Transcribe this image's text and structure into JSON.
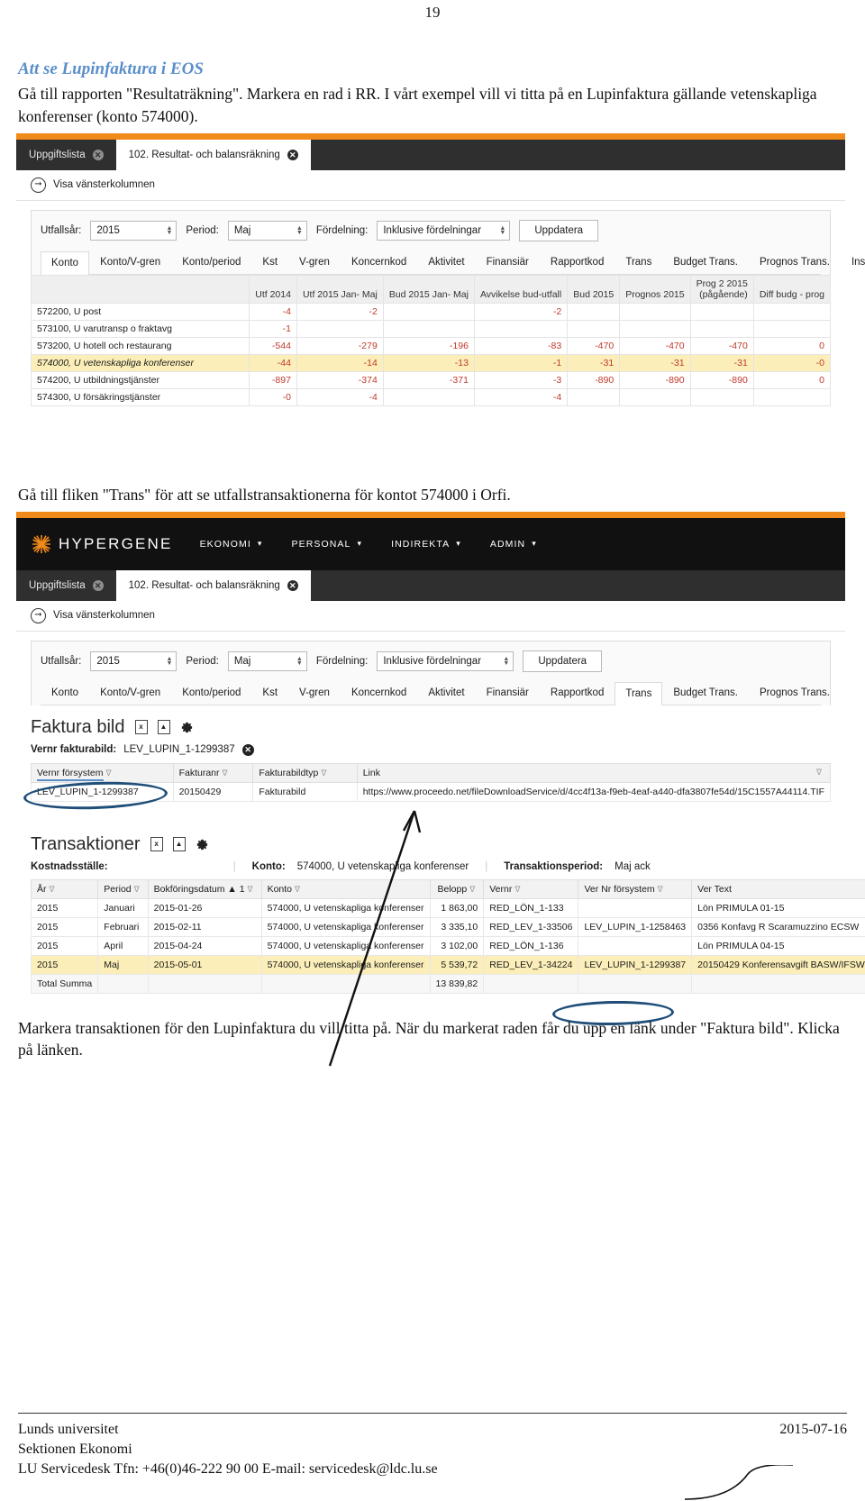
{
  "document": {
    "page_number": "19",
    "heading": "Att se Lupinfaktura i EOS",
    "intro_paragraph": "Gå till rapporten \"Resultaträkning\". Markera en rad i RR. I vårt exempel vill vi titta på en Lupinfaktura gällande vetenskapliga konferenser (konto 574000).",
    "middle_paragraph": "Gå till fliken \"Trans\" för att se utfallstransaktionerna för kontot 574000 i Orfi.",
    "closing_paragraph": "Markera transaktionen för den Lupinfaktura du vill titta på. När du markerat raden får du upp en länk under \"Faktura bild\". Klicka på länken.",
    "heading_color": "#5b8fc9"
  },
  "footer": {
    "org": "Lunds universitet",
    "date": "2015-07-16",
    "department": "Sektionen Ekonomi",
    "contact": "LU Servicedesk Tfn: +46(0)46-222 90 00 E-mail: servicedesk@ldc.lu.se"
  },
  "screenshot1": {
    "accent_color": "#f08a1a",
    "tabs": [
      {
        "label": "Uppgiftslista",
        "active": false,
        "close": "✕"
      },
      {
        "label": "102. Resultat- och balansräkning",
        "active": true,
        "close": "✕"
      }
    ],
    "left_column_toggle": "Visa vänsterkolumnen",
    "filters": [
      {
        "label": "Utfallsår:",
        "value": "2015"
      },
      {
        "label": "Period:",
        "value": "Maj"
      },
      {
        "label": "Fördelning:",
        "value": "Inklusive fördelningar"
      }
    ],
    "update_button": "Uppdatera",
    "subtabs": [
      {
        "label": "Konto",
        "active": true
      },
      {
        "label": "Konto/V-gren",
        "active": false
      },
      {
        "label": "Konto/period",
        "active": false
      },
      {
        "label": "Kst",
        "active": false
      },
      {
        "label": "V-gren",
        "active": false
      },
      {
        "label": "Koncernkod",
        "active": false
      },
      {
        "label": "Aktivitet",
        "active": false
      },
      {
        "label": "Finansiär",
        "active": false
      },
      {
        "label": "Rapportkod",
        "active": false
      },
      {
        "label": "Trans",
        "active": false
      },
      {
        "label": "Budget Trans.",
        "active": false
      },
      {
        "label": "Prognos Trans.",
        "active": false
      },
      {
        "label": "Inställningar",
        "active": false
      }
    ],
    "table": {
      "columns": [
        "",
        "Utf 2014",
        "Utf 2015 Jan- Maj",
        "Bud 2015 Jan- Maj",
        "Avvikelse bud-utfall",
        "Bud 2015",
        "Prognos 2015",
        "Prog 2 2015 (pågående)",
        "Diff budg - prog"
      ],
      "rows": [
        {
          "account": "572200, U post",
          "values": [
            "-4",
            "-2",
            "",
            "-2",
            "",
            "",
            "",
            ""
          ],
          "highlight": false
        },
        {
          "account": "573100, U varutransp o fraktavg",
          "values": [
            "-1",
            "",
            "",
            "",
            "",
            "",
            "",
            ""
          ],
          "highlight": false
        },
        {
          "account": "573200, U hotell och restaurang",
          "values": [
            "-544",
            "-279",
            "-196",
            "-83",
            "-470",
            "-470",
            "-470",
            "0"
          ],
          "highlight": false
        },
        {
          "account": "574000, U vetenskapliga konferenser",
          "values": [
            "-44",
            "-14",
            "-13",
            "-1",
            "-31",
            "-31",
            "-31",
            "-0"
          ],
          "highlight": true
        },
        {
          "account": "574200, U utbildningstjänster",
          "values": [
            "-897",
            "-374",
            "-371",
            "-3",
            "-890",
            "-890",
            "-890",
            "0"
          ],
          "highlight": false
        },
        {
          "account": "574300, U försäkringstjänster",
          "values": [
            "-0",
            "-4",
            "",
            "-4",
            "",
            "",
            "",
            ""
          ],
          "highlight": false
        }
      ]
    }
  },
  "screenshot2": {
    "accent_color": "#f08a1a",
    "brand": "HYPERGENE",
    "nav_items": [
      "EKONOMI",
      "PERSONAL",
      "INDIREKTA",
      "ADMIN"
    ],
    "tabs": [
      {
        "label": "Uppgiftslista",
        "active": false,
        "close": "✕"
      },
      {
        "label": "102. Resultat- och balansräkning",
        "active": true,
        "close": "✕"
      }
    ],
    "left_column_toggle": "Visa vänsterkolumnen",
    "filters": [
      {
        "label": "Utfallsår:",
        "value": "2015"
      },
      {
        "label": "Period:",
        "value": "Maj"
      },
      {
        "label": "Fördelning:",
        "value": "Inklusive fördelningar"
      }
    ],
    "update_button": "Uppdatera",
    "subtabs": [
      {
        "label": "Konto",
        "active": false
      },
      {
        "label": "Konto/V-gren",
        "active": false
      },
      {
        "label": "Konto/period",
        "active": false
      },
      {
        "label": "Kst",
        "active": false
      },
      {
        "label": "V-gren",
        "active": false
      },
      {
        "label": "Koncernkod",
        "active": false
      },
      {
        "label": "Aktivitet",
        "active": false
      },
      {
        "label": "Finansiär",
        "active": false
      },
      {
        "label": "Rapportkod",
        "active": false
      },
      {
        "label": "Trans",
        "active": true
      },
      {
        "label": "Budget Trans.",
        "active": false
      },
      {
        "label": "Prognos Trans.",
        "active": false
      }
    ],
    "faktura_bild": {
      "title": "Faktura bild",
      "icons": [
        "excel-export-icon",
        "pdf-export-icon",
        "gear-icon"
      ],
      "filter_label": "Vernr fakturabild:",
      "filter_value": "LEV_LUPIN_1-1299387",
      "columns": [
        "Vernr försystem",
        "Fakturanr",
        "Fakturabildtyp",
        "Link"
      ],
      "rows": [
        {
          "vernr_forsystem": "LEV_LUPIN_1-1299387",
          "fakturanr": "20150429",
          "fakturabildtyp": "Fakturabild",
          "link": "https://www.proceedo.net/fileDownloadService/d/4cc4f13a-f9eb-4eaf-a440-dfa3807fe54d/15C1557A44114.TIF"
        }
      ]
    },
    "transaktioner": {
      "title": "Transaktioner",
      "icons": [
        "excel-export-icon",
        "pdf-export-icon",
        "gear-icon"
      ],
      "meta": [
        {
          "label": "Kostnadsställe:",
          "value": ""
        },
        {
          "label": "Konto:",
          "value": "574000, U vetenskapliga konferenser"
        },
        {
          "label": "Transaktionsperiod:",
          "value": "Maj ack"
        }
      ],
      "columns": [
        "År",
        "Period",
        "Bokföringsdatum ▲ 1",
        "Konto",
        "Belopp",
        "Vernr",
        "Ver Nr försystem",
        "Ver Text"
      ],
      "rows": [
        {
          "ar": "2015",
          "period": "Januari",
          "datum": "2015-01-26",
          "konto": "574000, U vetenskapliga konferenser",
          "belopp": "1 863,00",
          "vernr": "RED_LÖN_1-133",
          "ver_nr_forsystem": "",
          "ver_text": "Lön PRIMULA 01-15",
          "highlight": false
        },
        {
          "ar": "2015",
          "period": "Februari",
          "datum": "2015-02-11",
          "konto": "574000, U vetenskapliga konferenser",
          "belopp": "3 335,10",
          "vernr": "RED_LEV_1-33506",
          "ver_nr_forsystem": "LEV_LUPIN_1-1258463",
          "ver_text": "0356 Konfavg R Scaramuzzino ECSW",
          "highlight": false
        },
        {
          "ar": "2015",
          "period": "April",
          "datum": "2015-04-24",
          "konto": "574000, U vetenskapliga konferenser",
          "belopp": "3 102,00",
          "vernr": "RED_LÖN_1-136",
          "ver_nr_forsystem": "",
          "ver_text": "Lön PRIMULA 04-15",
          "highlight": false
        },
        {
          "ar": "2015",
          "period": "Maj",
          "datum": "2015-05-01",
          "konto": "574000, U vetenskapliga konferenser",
          "belopp": "5 539,72",
          "vernr": "RED_LEV_1-34224",
          "ver_nr_forsystem": "LEV_LUPIN_1-1299387",
          "ver_text": "20150429 Konferensavgift BASW/IFSW",
          "highlight": true
        }
      ],
      "total_label": "Total Summa",
      "total_value": "13 839,82"
    }
  }
}
